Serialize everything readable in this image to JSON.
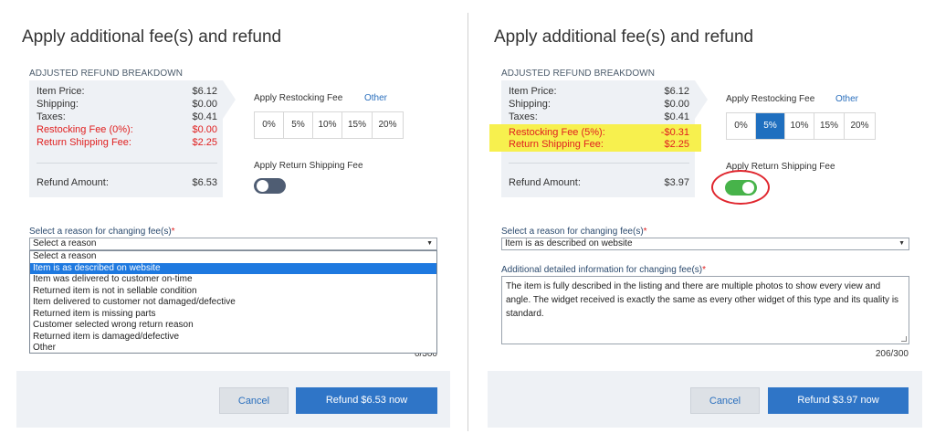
{
  "left": {
    "title": "Apply additional fee(s) and refund",
    "section_label": "ADJUSTED REFUND BREAKDOWN",
    "breakdown": {
      "item_price_label": "Item Price:",
      "item_price": "$6.12",
      "shipping_label": "Shipping:",
      "shipping": "$0.00",
      "taxes_label": "Taxes:",
      "taxes": "$0.41",
      "restocking_label": "Restocking Fee (0%):",
      "restocking": "$0.00",
      "return_ship_label": "Return Shipping Fee:",
      "return_ship": "$2.25",
      "refund_label": "Refund Amount:",
      "refund": "$6.53"
    },
    "restocking_title": "Apply Restocking Fee",
    "other_link": "Other",
    "percentages": [
      "0%",
      "5%",
      "10%",
      "15%",
      "20%"
    ],
    "active_percentage": null,
    "return_shipping_title": "Apply Return Shipping Fee",
    "return_shipping_on": false,
    "reason_label": "Select a reason for changing fee(s)",
    "required_mark": "*",
    "reason_selected": "Select a reason",
    "dropdown_options": [
      "Select a reason",
      "Item is as described on website",
      "Item was delivered to customer on-time",
      "Returned item is not in sellable condition",
      "Item delivered to customer not damaged/defective",
      "Returned item is missing parts",
      "Customer selected wrong return reason",
      "Returned item is damaged/defective",
      "Other"
    ],
    "highlighted_option": "Item is as described on website",
    "counter_partial": "0/300",
    "cancel_label": "Cancel",
    "refund_button_label": "Refund $6.53 now"
  },
  "right": {
    "title": "Apply additional fee(s) and refund",
    "section_label": "ADJUSTED REFUND BREAKDOWN",
    "breakdown": {
      "item_price_label": "Item Price:",
      "item_price": "$6.12",
      "shipping_label": "Shipping:",
      "shipping": "$0.00",
      "taxes_label": "Taxes:",
      "taxes": "$0.41",
      "restocking_label": "Restocking Fee (5%):",
      "restocking": "-$0.31",
      "return_ship_label": "Return Shipping Fee:",
      "return_ship": "$2.25",
      "refund_label": "Refund Amount:",
      "refund": "$3.97"
    },
    "restocking_title": "Apply Restocking Fee",
    "other_link": "Other",
    "percentages": [
      "0%",
      "5%",
      "10%",
      "15%",
      "20%"
    ],
    "active_percentage": "5%",
    "return_shipping_title": "Apply Return Shipping Fee",
    "return_shipping_on": true,
    "reason_label": "Select a reason for changing fee(s)",
    "required_mark": "*",
    "reason_selected": "Item is as described on website",
    "details_label": "Additional detailed information for changing fee(s)",
    "details_text": "The item is fully described in the listing and there are multiple photos to show every view and angle. The widget received is exactly the same as every other widget of this type and its quality is standard.",
    "counter": "206/300",
    "cancel_label": "Cancel",
    "refund_button_label": "Refund $3.97 now"
  },
  "colors": {
    "accent_blue": "#2f75c7",
    "fee_red": "#e02020",
    "highlight_yellow": "#f7f04e",
    "toggle_on_green": "#47b34a",
    "toggle_off_slate": "#4f5d73",
    "annotation_circle_red": "#e0262e"
  }
}
